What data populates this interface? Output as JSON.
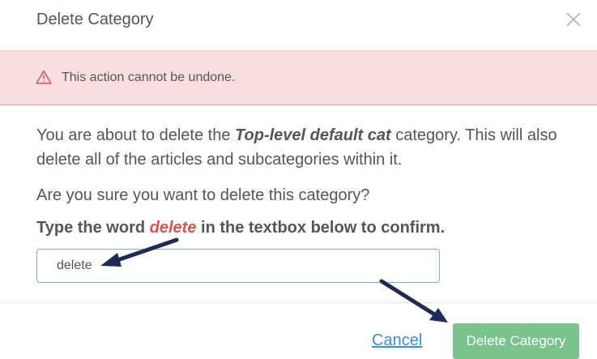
{
  "modal": {
    "title": "Delete Category",
    "close_icon": "close-icon"
  },
  "alert": {
    "icon": "warning-icon",
    "text": "This action cannot be undone."
  },
  "body": {
    "p1_before": "You are about to delete the ",
    "category_name": "Top-level default cat",
    "p1_after": " category. This will also delete all of the articles and subcategories within it.",
    "question": "Are you sure you want to delete this category?",
    "confirm_before": "Type the word ",
    "confirm_word": "delete",
    "confirm_after": " in the textbox below to confirm."
  },
  "input": {
    "value": "delete"
  },
  "footer": {
    "cancel_label": "Cancel",
    "delete_label": "Delete Category"
  },
  "colors": {
    "alert_bg": "#f8dede",
    "danger_red": "#d9534f",
    "button_green": "#7ac38d",
    "link_blue": "#3b8fd5",
    "annotation_arrow": "#1f2a55"
  }
}
